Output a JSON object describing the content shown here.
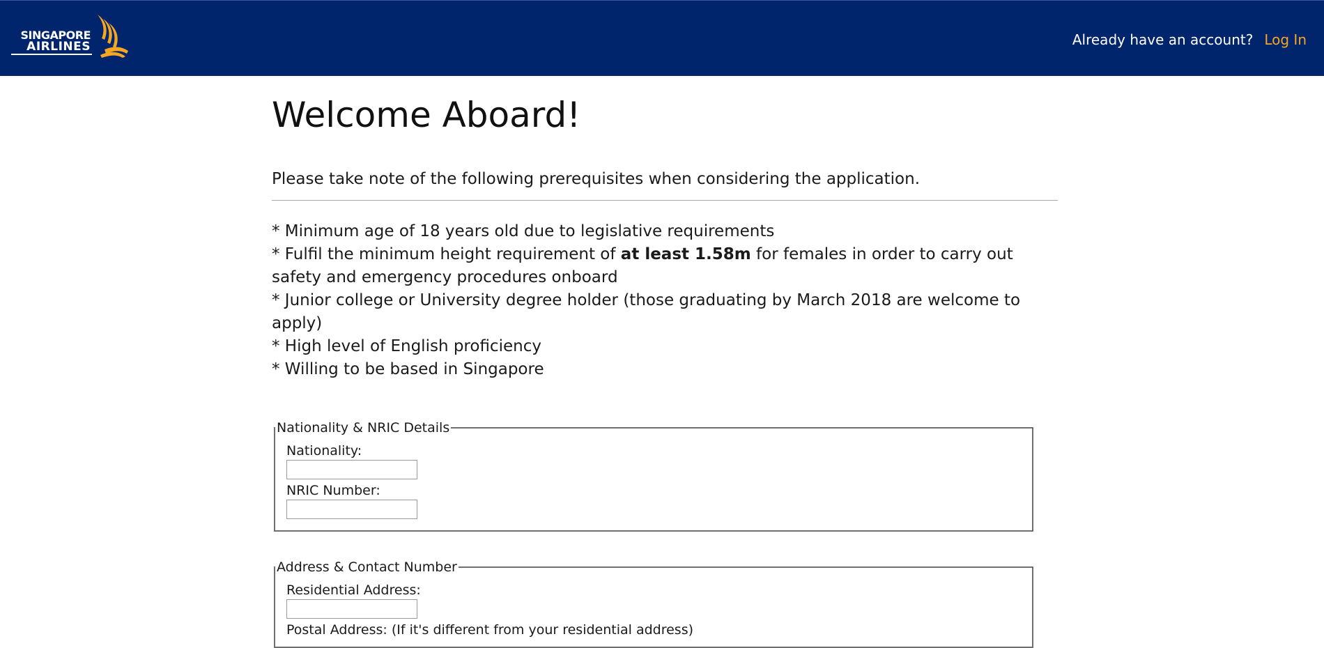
{
  "header": {
    "logo_line1": "SINGAPORE",
    "logo_line2": "AIRLINES",
    "account_prompt": "Already have an account?",
    "login_label": "Log In",
    "bg_color": "#00256c",
    "login_color": "#f5a623"
  },
  "main": {
    "title": "Welcome Aboard!",
    "intro": "Please take note of the following prerequisites when considering the application.",
    "prereqs": [
      {
        "pre": "* Minimum age of 18 years old due to legislative requirements",
        "bold": "",
        "post": ""
      },
      {
        "pre": "* Fulfil the minimum height requirement of ",
        "bold": "at least 1.58m",
        "post": " for females in order to carry out safety and emergency procedures onboard"
      },
      {
        "pre": "* Junior college or University degree holder (those graduating by March 2018 are welcome to apply)",
        "bold": "",
        "post": ""
      },
      {
        "pre": "* High level of English proficiency",
        "bold": "",
        "post": ""
      },
      {
        "pre": "* Willing to be based in Singapore",
        "bold": "",
        "post": ""
      }
    ]
  },
  "form": {
    "nric_section": {
      "legend": "Nationality & NRIC Details",
      "nationality_label": "Nationality:",
      "nationality_value": "",
      "nric_label": "NRIC Number:",
      "nric_value": ""
    },
    "address_section": {
      "legend": "Address & Contact Number",
      "residential_label": "Residential Address:",
      "residential_value": "",
      "postal_label": "Postal Address: (If it's different from your residential address)"
    }
  }
}
